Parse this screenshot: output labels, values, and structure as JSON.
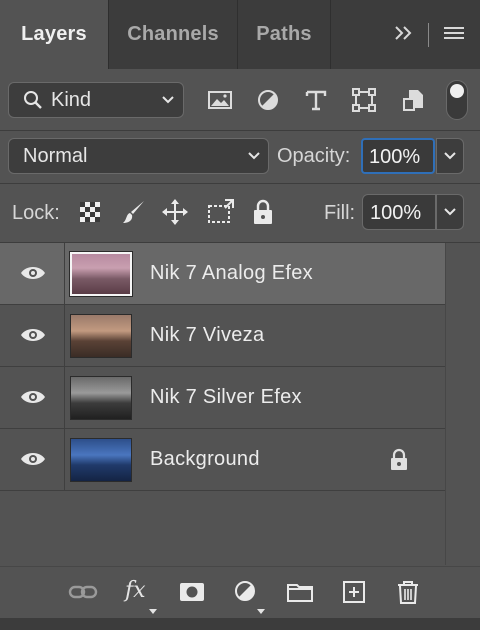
{
  "tabs": [
    {
      "label": "Layers",
      "active": true
    },
    {
      "label": "Channels",
      "active": false
    },
    {
      "label": "Paths",
      "active": false
    }
  ],
  "filter": {
    "kind_label": "Kind"
  },
  "blend_mode": "Normal",
  "opacity": {
    "label": "Opacity:",
    "value": "100%"
  },
  "lock": {
    "label": "Lock:"
  },
  "fill": {
    "label": "Fill:",
    "value": "100%"
  },
  "layers": [
    {
      "name": "Nik 7 Analog Efex",
      "selected": true,
      "visible": true,
      "locked": false
    },
    {
      "name": "Nik 7 Viveza",
      "selected": false,
      "visible": true,
      "locked": false
    },
    {
      "name": "Nik 7 Silver Efex",
      "selected": false,
      "visible": true,
      "locked": false
    },
    {
      "name": "Background",
      "selected": false,
      "visible": true,
      "locked": true
    }
  ],
  "footer": {
    "fx_label": "fx"
  },
  "colors": {
    "panel_bg": "#535353",
    "tabbar_bg": "#3c3c3c",
    "selected_row": "#686868",
    "focus_blue": "#2f6fb8"
  }
}
